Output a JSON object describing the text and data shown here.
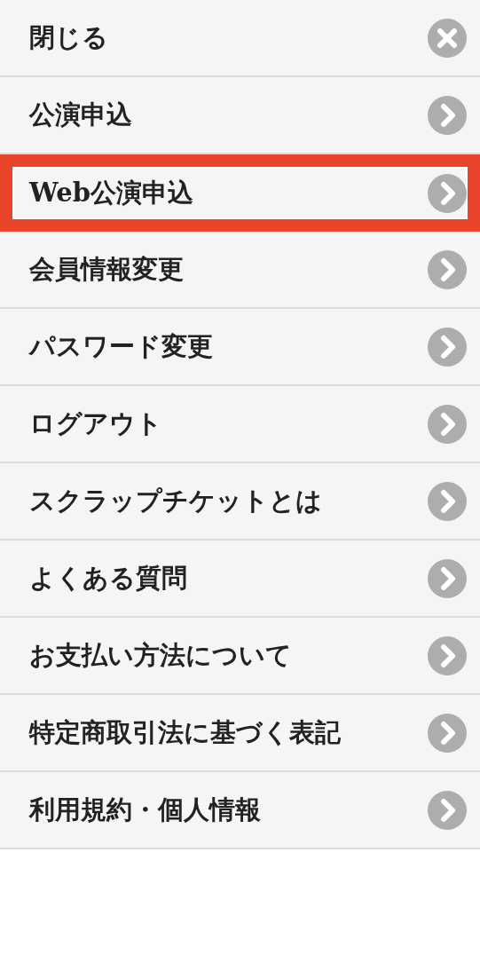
{
  "menu": {
    "items": [
      {
        "label": "閉じる",
        "kind": "close",
        "highlighted": false
      },
      {
        "label": "公演申込",
        "kind": "link",
        "highlighted": false
      },
      {
        "label": "Web公演申込",
        "kind": "link",
        "highlighted": true
      },
      {
        "label": "会員情報変更",
        "kind": "link",
        "highlighted": false
      },
      {
        "label": "パスワード変更",
        "kind": "link",
        "highlighted": false
      },
      {
        "label": "ログアウト",
        "kind": "link",
        "highlighted": false
      },
      {
        "label": "スクラップチケットとは",
        "kind": "link",
        "highlighted": false
      },
      {
        "label": "よくある質問",
        "kind": "link",
        "highlighted": false
      },
      {
        "label": "お支払い方法について",
        "kind": "link",
        "highlighted": false
      },
      {
        "label": "特定商取引法に基づく表記",
        "kind": "link",
        "highlighted": false
      },
      {
        "label": "利用規約・個人情報",
        "kind": "link",
        "highlighted": false
      }
    ]
  }
}
